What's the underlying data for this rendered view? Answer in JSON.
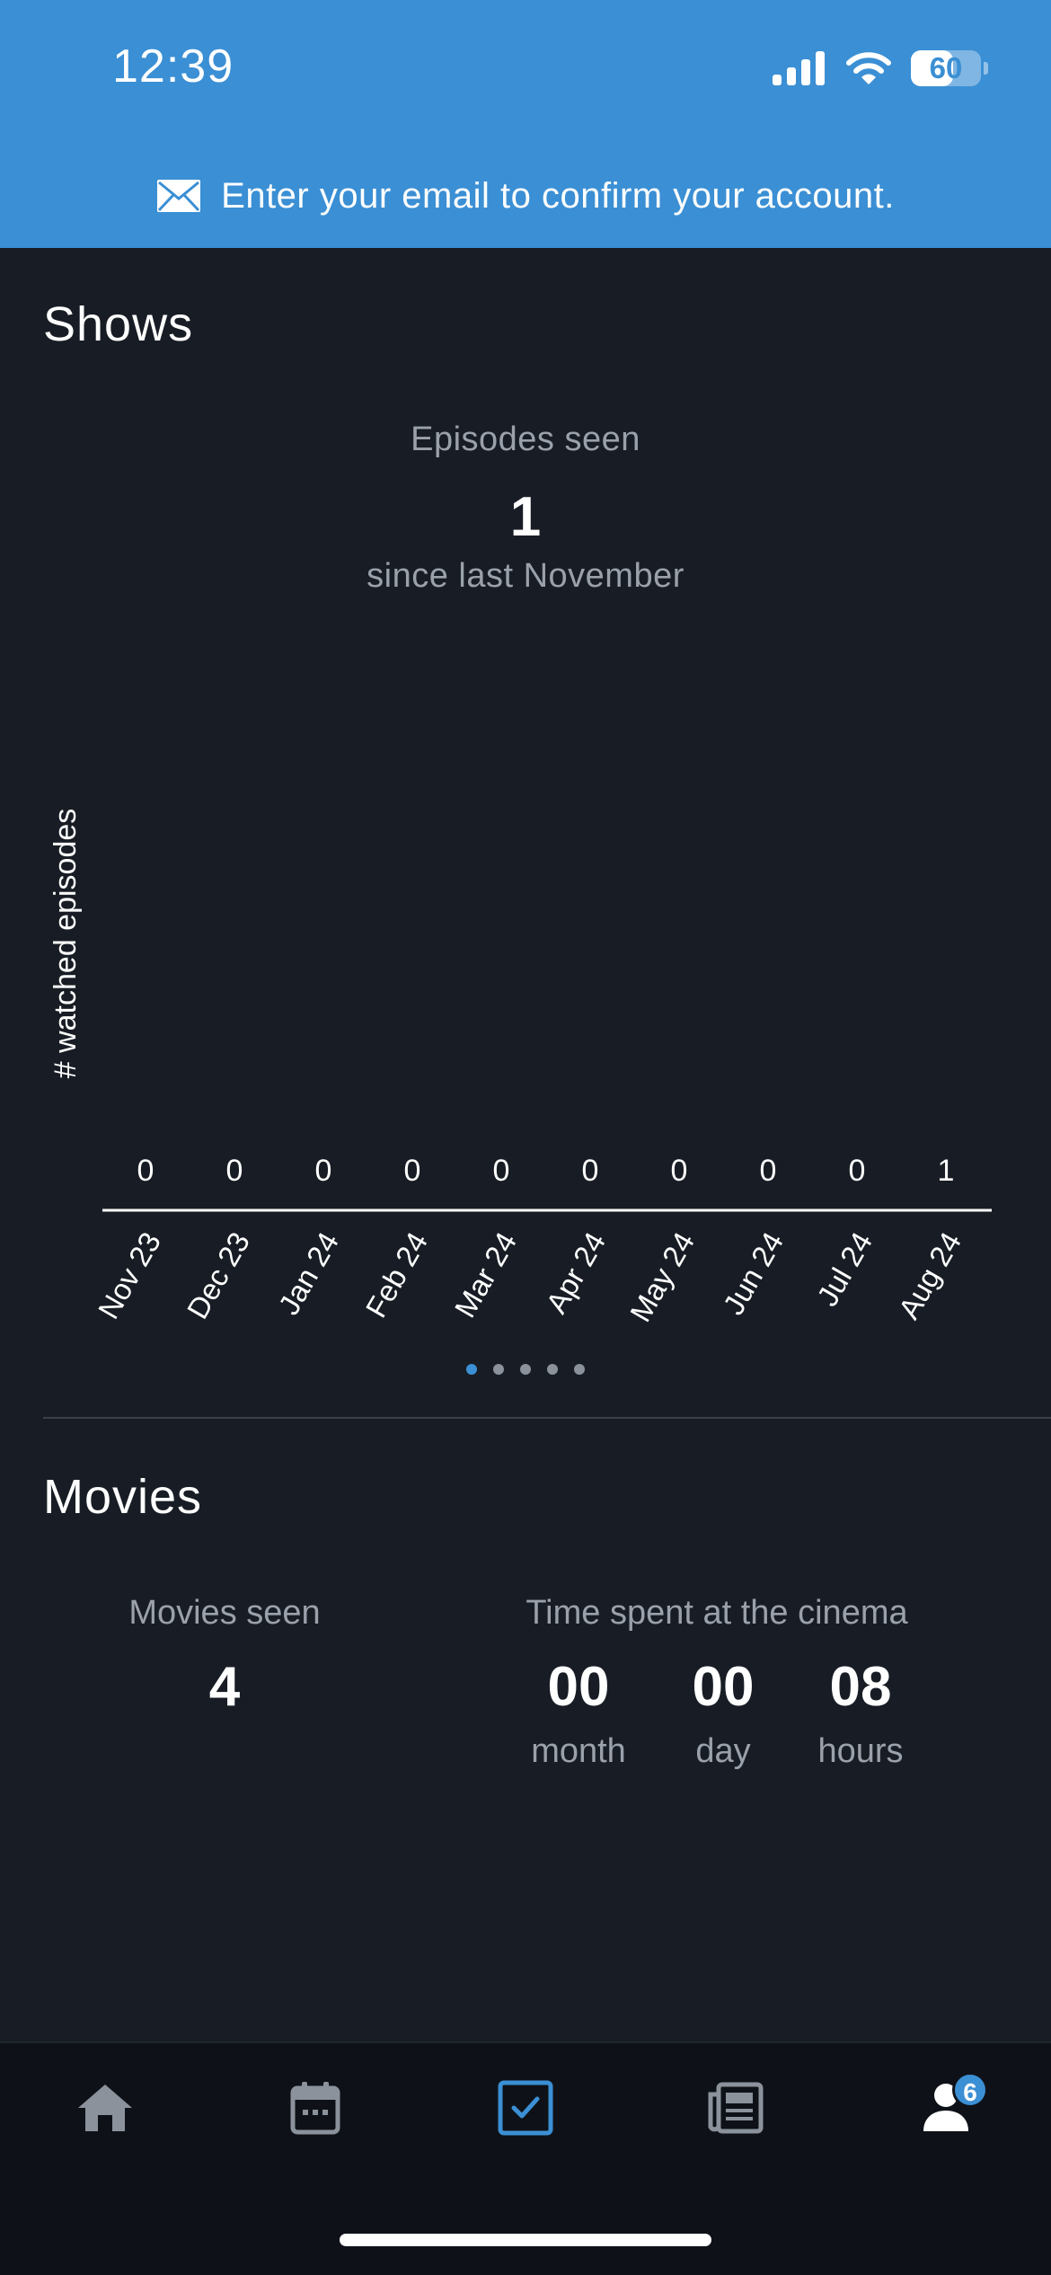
{
  "status_bar": {
    "time": "12:39",
    "battery": "60",
    "battery_level": 0.6
  },
  "banner": {
    "icon": "mail-icon",
    "text": "Enter your email to confirm your account."
  },
  "shows": {
    "title": "Shows",
    "episodes_label": "Episodes seen",
    "episodes_value": "1",
    "episodes_since": "since last November"
  },
  "chart_data": {
    "type": "bar",
    "ylabel": "# watched episodes",
    "categories": [
      "Nov 23",
      "Dec 23",
      "Jan 24",
      "Feb 24",
      "Mar 24",
      "Apr 24",
      "May 24",
      "Jun 24",
      "Jul 24",
      "Aug 24"
    ],
    "values": [
      0,
      0,
      0,
      0,
      0,
      0,
      0,
      0,
      0,
      1
    ],
    "value_labels": [
      "0",
      "0",
      "0",
      "0",
      "0",
      "0",
      "0",
      "0",
      "0",
      "1"
    ]
  },
  "pager": {
    "count": 5,
    "active": 0
  },
  "movies": {
    "title": "Movies",
    "seen_label": "Movies seen",
    "seen_value": "4",
    "cinema_label": "Time spent at the cinema",
    "month_value": "00",
    "month_unit": "month",
    "day_value": "00",
    "day_unit": "day",
    "hours_value": "08",
    "hours_unit": "hours"
  },
  "tabbar": {
    "items": [
      {
        "icon": "home-icon"
      },
      {
        "icon": "calendar-icon"
      },
      {
        "icon": "checkbox-icon",
        "active": true
      },
      {
        "icon": "news-icon"
      },
      {
        "icon": "profile-icon",
        "badge": "6"
      }
    ],
    "active_color": "#3b8fd4",
    "inactive_color": "#8b929b"
  },
  "colors": {
    "accent": "#3b8fd4",
    "background": "#181d25",
    "muted_text": "#9aa1ab"
  }
}
